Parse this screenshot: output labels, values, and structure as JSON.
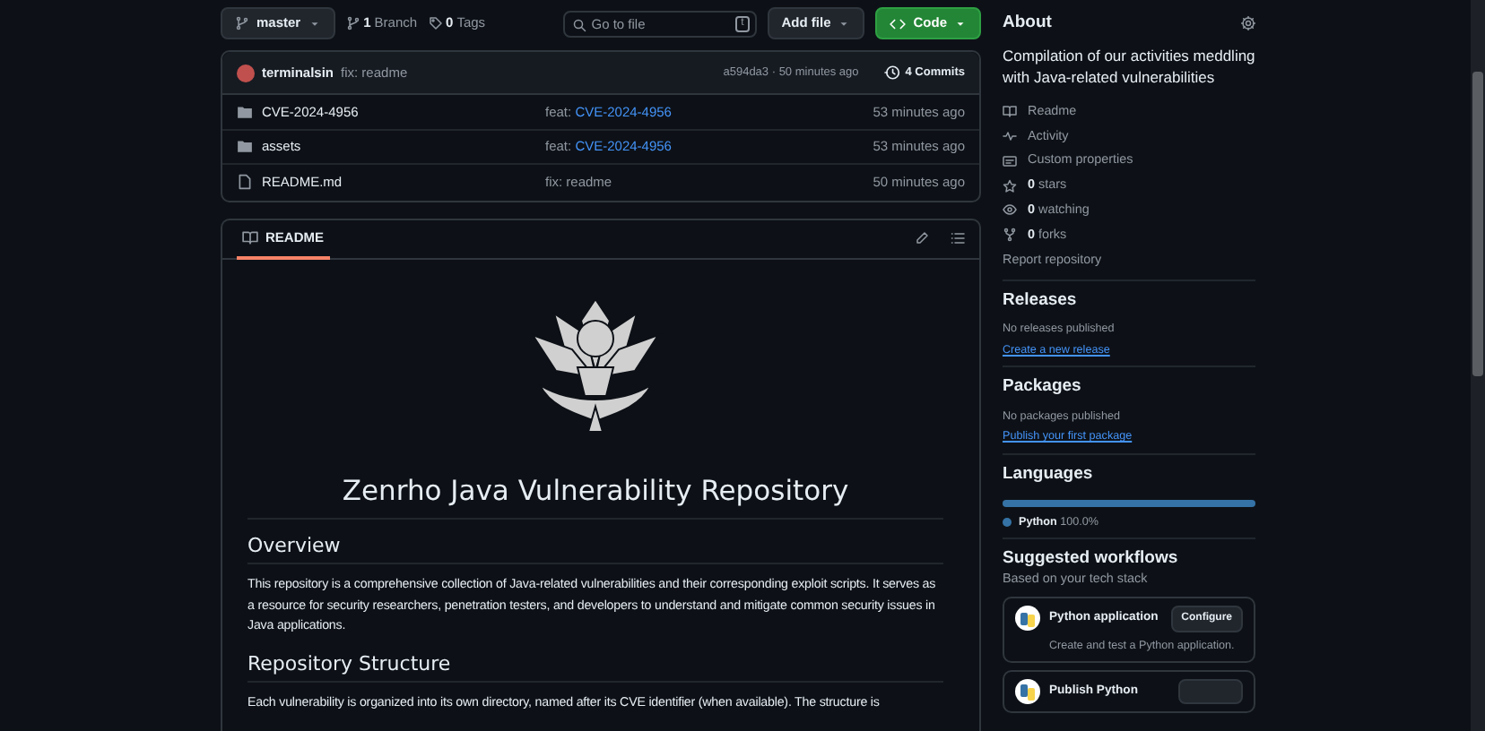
{
  "toolbar": {
    "branch": "master",
    "branch_count": "1",
    "branch_label": "Branch",
    "tag_count": "0",
    "tag_label": "Tags",
    "search": {
      "placeholder": "Go to file",
      "shortcut": "t"
    },
    "add_file": "Add file",
    "code": "Code"
  },
  "commit": {
    "author": "terminalsin",
    "message": "fix: readme",
    "hash": "a594da3 · 50 minutes ago",
    "commits": "4 Commits"
  },
  "files": [
    {
      "kind": "folder",
      "name": "CVE-2024-4956",
      "message": "feat: ",
      "message_link": "CVE-2024-4956",
      "time": "53 minutes ago"
    },
    {
      "kind": "folder",
      "name": "assets",
      "message": "feat: ",
      "message_link": "CVE-2024-4956",
      "time": "53 minutes ago"
    },
    {
      "kind": "file",
      "name": "README.md",
      "message": "fix: readme",
      "time": "50 minutes ago"
    }
  ],
  "readme": {
    "tab": "README",
    "title": "Zenrho Java Vulnerability Repository",
    "sections": [
      {
        "heading": "Overview",
        "text": "This repository is a comprehensive collection of Java-related vulnerabilities and their corresponding exploit scripts. It serves as a resource for security researchers, penetration testers, and developers to understand and mitigate common security issues in Java applications."
      },
      {
        "heading": "Repository Structure",
        "text": "Each vulnerability is organized into its own directory, named after its CVE identifier (when available). The structure is"
      }
    ]
  },
  "about": {
    "title": "About",
    "description": "Compilation of our activities meddling with Java-related vulnerabilities",
    "links": [
      {
        "kind": "book",
        "label": "Readme"
      },
      {
        "kind": "pulse",
        "label": "Activity"
      },
      {
        "kind": "note",
        "label": "Custom properties"
      },
      {
        "kind": "star",
        "count": "0",
        "label": "stars"
      },
      {
        "kind": "eye",
        "count": "0",
        "label": "watching"
      },
      {
        "kind": "fork",
        "count": "0",
        "label": "forks"
      }
    ],
    "report": "Report repository"
  },
  "releases": {
    "title": "Releases",
    "note": "No releases published",
    "link": "Create a new release"
  },
  "packages": {
    "title": "Packages",
    "note": "No packages published",
    "link": "Publish your first package"
  },
  "languages": {
    "title": "Languages",
    "items": [
      {
        "name": "Python",
        "percent": "100.0%",
        "color": "#3572a5",
        "level": 1
      }
    ]
  },
  "workflows": {
    "title": "Suggested workflows",
    "subtitle": "Based on your tech stack",
    "items": [
      {
        "name": "Python application",
        "button": "Configure",
        "description": "Create and test a Python application."
      },
      {
        "name": "Publish Python"
      }
    ]
  }
}
